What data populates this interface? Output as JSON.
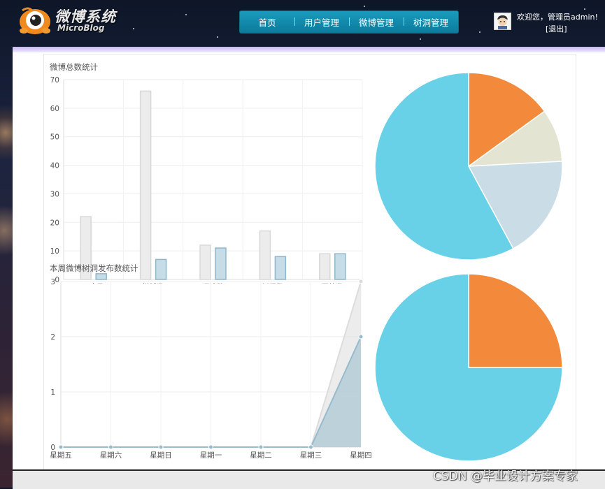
{
  "app": {
    "logo_title": "微博系统",
    "logo_subtitle": "MicroBlog"
  },
  "nav": {
    "items": [
      {
        "label": "首页"
      },
      {
        "label": "用户管理"
      },
      {
        "label": "微博管理"
      },
      {
        "label": "树洞管理"
      }
    ]
  },
  "user": {
    "welcome": "欢迎您，管理员admin!",
    "logout": "[退出]"
  },
  "colors": {
    "orange": "#f3893a",
    "beige": "#e4e4d2",
    "lightblue": "#cadde6",
    "cyan": "#68d1e7",
    "gray_bar": "#ececec",
    "blue_bar": "#c6dde8"
  },
  "watermark": "CSDN @毕业设计方案专家",
  "chart_data": [
    {
      "type": "bar",
      "title": "微博总数统计",
      "categories": [
        "用户数",
        "微博数",
        "评论数",
        "树洞数",
        "回答数"
      ],
      "series": [
        {
          "values": [
            22,
            66,
            12,
            17,
            9
          ]
        },
        {
          "values": [
            2,
            7,
            11,
            8,
            9
          ]
        }
      ],
      "ylim": [
        0,
        70
      ],
      "yticks": [
        0,
        10,
        20,
        30,
        40,
        50,
        60,
        70
      ],
      "grid": true
    },
    {
      "type": "area",
      "title": "本周微博树洞发布数统计",
      "categories": [
        "星期五",
        "星期六",
        "星期日",
        "星期一",
        "星期二",
        "星期三",
        "星期四"
      ],
      "series": [
        {
          "values": [
            0,
            0,
            0,
            0,
            0,
            0,
            3
          ]
        },
        {
          "values": [
            0,
            0,
            0,
            0,
            0,
            0,
            2
          ]
        }
      ],
      "ylim": [
        0,
        3
      ],
      "yticks": [
        0,
        1,
        2,
        3
      ],
      "grid": true
    },
    {
      "type": "pie",
      "values": [
        0.15,
        0.0915,
        0.1795,
        0.579
      ],
      "colors": [
        "#f3893a",
        "#e4e4d2",
        "#cadde6",
        "#68d1e7"
      ]
    },
    {
      "type": "pie",
      "values": [
        0.25,
        0.75
      ],
      "colors": [
        "#f3893a",
        "#68d1e7"
      ]
    }
  ]
}
